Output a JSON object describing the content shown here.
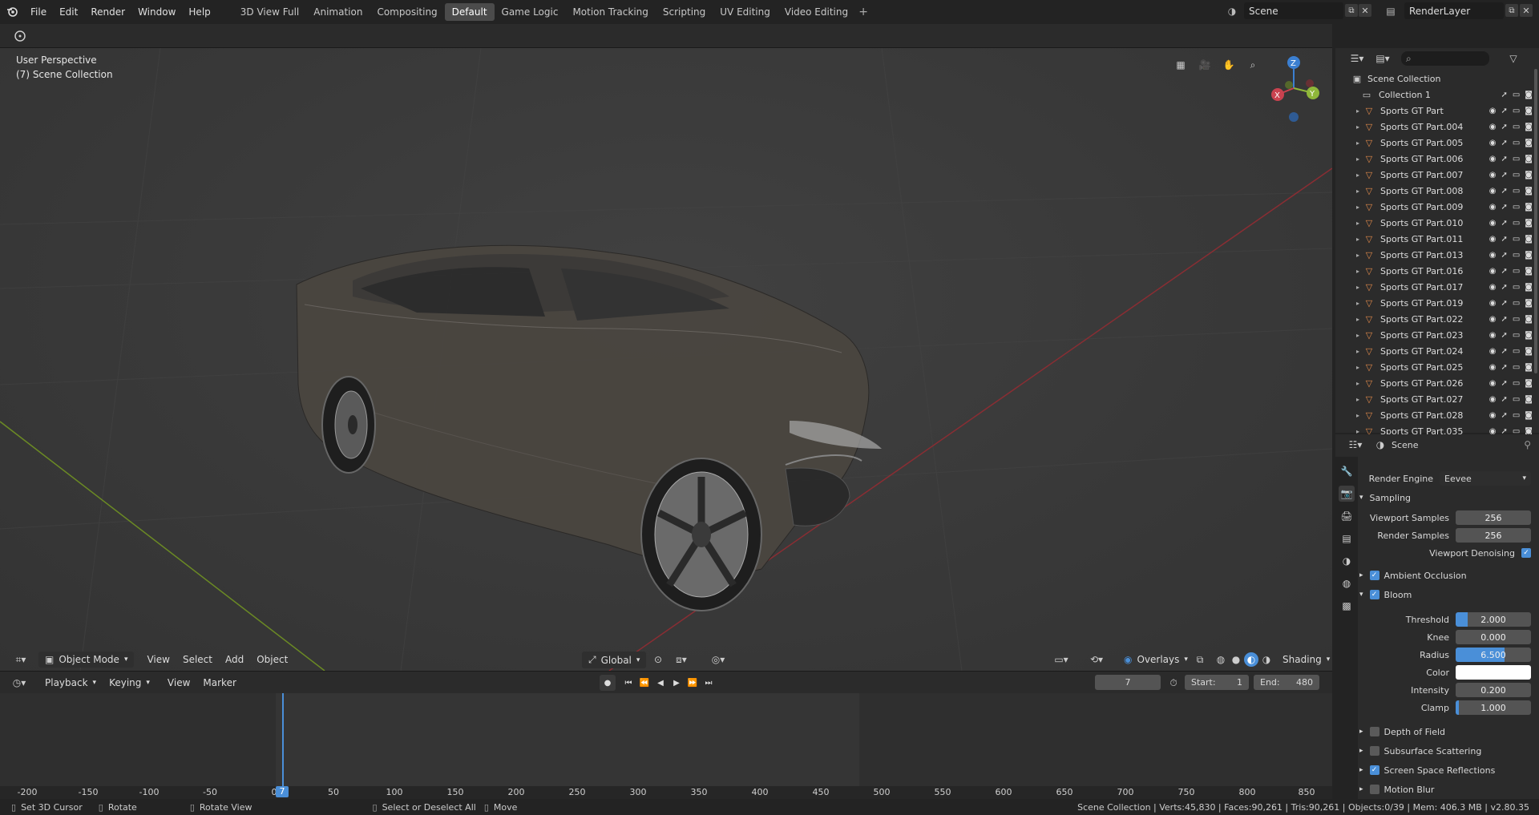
{
  "topbar": {
    "menus": [
      "File",
      "Edit",
      "Render",
      "Window",
      "Help"
    ],
    "workspaces": [
      "3D View Full",
      "Animation",
      "Compositing",
      "Default",
      "Game Logic",
      "Motion Tracking",
      "Scripting",
      "UV Editing",
      "Video Editing"
    ],
    "active_workspace": "Default",
    "scene": "Scene",
    "view_layer": "RenderLayer"
  },
  "viewport": {
    "perspective": "User Perspective",
    "collection": "(7) Scene Collection",
    "gizmo": {
      "z": "Z",
      "y": "Y",
      "x": "X"
    },
    "header": {
      "mode": "Object Mode",
      "menus": [
        "View",
        "Select",
        "Add",
        "Object"
      ],
      "orientation": "Global",
      "overlays": "Overlays",
      "shading": "Shading"
    }
  },
  "timeline": {
    "menus": [
      "Playback",
      "Keying",
      "View",
      "Marker"
    ],
    "current_frame": "7",
    "start_label": "Start:",
    "start": "1",
    "end_label": "End:",
    "end": "480",
    "ticks": [
      "-200",
      "-150",
      "-100",
      "-50",
      "0",
      "50",
      "100",
      "150",
      "200",
      "250",
      "300",
      "350",
      "400",
      "450",
      "500",
      "550",
      "600",
      "650",
      "700",
      "750",
      "800",
      "850"
    ],
    "frame_marker": "7"
  },
  "statusbar": {
    "hint1": "Set 3D Cursor",
    "hint2": "Rotate",
    "hint3": "Rotate View",
    "hint4": "Select or Deselect All",
    "hint5": "Move",
    "stats": "Scene Collection | Verts:45,830 | Faces:90,261 | Tris:90,261 | Objects:0/39 | Mem: 406.3 MB | v2.80.35"
  },
  "outliner": {
    "root": "Scene Collection",
    "collection": "Collection 1",
    "objects": [
      "Sports GT Part",
      "Sports GT Part.004",
      "Sports GT Part.005",
      "Sports GT Part.006",
      "Sports GT Part.007",
      "Sports GT Part.008",
      "Sports GT Part.009",
      "Sports GT Part.010",
      "Sports GT Part.011",
      "Sports GT Part.013",
      "Sports GT Part.016",
      "Sports GT Part.017",
      "Sports GT Part.019",
      "Sports GT Part.022",
      "Sports GT Part.023",
      "Sports GT Part.024",
      "Sports GT Part.025",
      "Sports GT Part.026",
      "Sports GT Part.027",
      "Sports GT Part.028",
      "Sports GT Part.035"
    ]
  },
  "properties": {
    "context": "Scene",
    "render_engine_label": "Render Engine",
    "render_engine": "Eevee",
    "sampling": "Sampling",
    "viewport_samples_label": "Viewport Samples",
    "viewport_samples": "256",
    "render_samples_label": "Render Samples",
    "render_samples": "256",
    "viewport_denoising": "Viewport Denoising",
    "ambient_occlusion": "Ambient Occlusion",
    "bloom": "Bloom",
    "threshold_label": "Threshold",
    "threshold": "2.000",
    "knee_label": "Knee",
    "knee": "0.000",
    "radius_label": "Radius",
    "radius": "6.500",
    "color_label": "Color",
    "intensity_label": "Intensity",
    "intensity": "0.200",
    "clamp_label": "Clamp",
    "clamp": "1.000",
    "depth_of_field": "Depth of Field",
    "subsurface": "Subsurface Scattering",
    "ssr": "Screen Space Reflections",
    "motion_blur": "Motion Blur"
  },
  "colors": {
    "accent": "#4a8fd8",
    "x_axis": "#c9424f",
    "y_axis": "#8fb73a",
    "z_axis": "#3b7fd1"
  }
}
